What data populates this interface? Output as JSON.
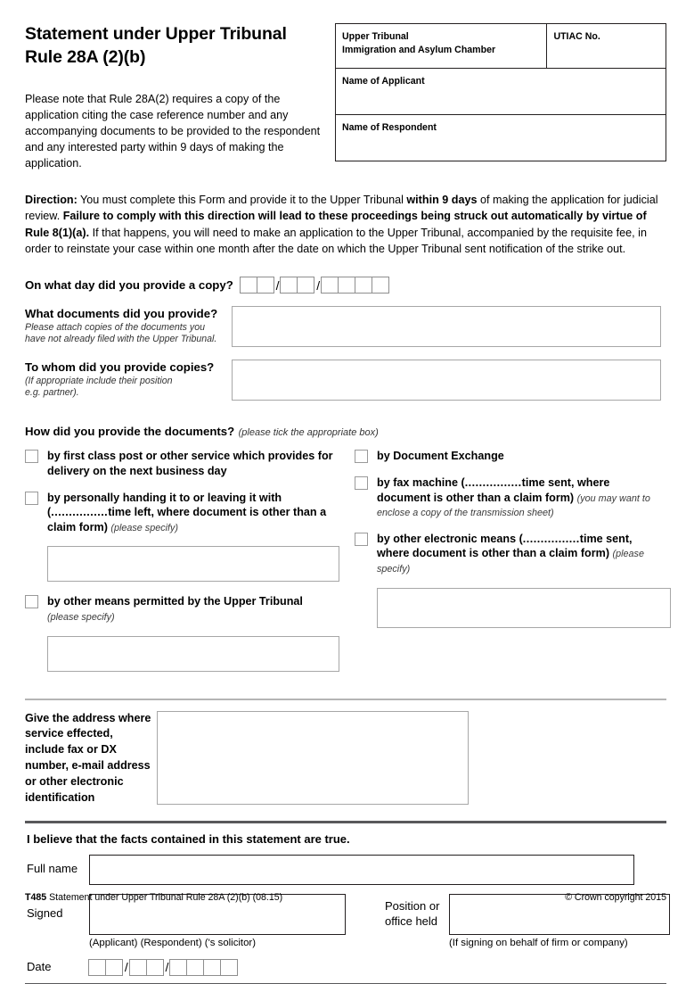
{
  "header": {
    "title": "Statement under Upper Tribunal Rule 28A (2)(b)",
    "intro": "Please note that Rule 28A(2) requires a copy of the application citing the case reference number and any accompanying documents to be provided to the respondent and any interested party within 9 days of making the application.",
    "box": {
      "chamber_line1": "Upper Tribunal",
      "chamber_line2": "Immigration and Asylum Chamber",
      "utiac_label": "UTIAC No.",
      "applicant_label": "Name of Applicant",
      "respondent_label": "Name of Respondent"
    }
  },
  "direction": {
    "lead": "Direction:",
    "part1": " You must complete this Form and provide it to the Upper Tribunal ",
    "bold1": "within 9 days",
    "part2": " of making the application for judicial review. ",
    "bold2": "Failure to comply with this direction will lead to these proceedings being struck out automatically by virtue of Rule 8(1)(a).",
    "part3": " If that happens, you will need to make an application to the Upper Tribunal, accompanied by the requisite fee, in order to reinstate your case within one month after the date on which the Upper Tribunal sent notification of the strike out."
  },
  "questions": {
    "day_provided": "On what day did you provide a copy?",
    "date_groups": [
      2,
      2,
      4
    ],
    "date_separator": "/",
    "what_documents": {
      "label": "What documents did you provide?",
      "sub_line1": "Please attach copies of the documents you",
      "sub_line2": "have not already filed with the Upper Tribunal."
    },
    "to_whom": {
      "label": "To whom did you provide copies?",
      "sub_line1": "(If appropriate include their position",
      "sub_line2": "e.g. partner)."
    }
  },
  "how_section": {
    "heading": "How did you provide the documents?",
    "heading_italic": "(please tick the appropriate box)",
    "left_options": [
      {
        "name": "first-class-post",
        "text": "by first class post or other service which provides for delivery on the next business day",
        "italic": "",
        "has_box": false
      },
      {
        "name": "personally-handing",
        "text_pre": "by personally handing it to or leaving it with (",
        "dots": "................",
        "text_post": "time left, where document is other than a claim form)",
        "italic": "(please specify)",
        "has_box": true
      },
      {
        "name": "other-means-permitted",
        "text": "by other means permitted by the Upper Tribunal",
        "italic": "(please specify)",
        "has_box": true
      }
    ],
    "right_options": [
      {
        "name": "document-exchange",
        "text": "by Document Exchange",
        "italic": "",
        "has_box": false
      },
      {
        "name": "fax-machine",
        "text_pre": "by fax machine (",
        "dots": "................",
        "text_post": "time sent, where document is other than a claim form)",
        "italic": "(you may want to enclose a copy of the transmission sheet)",
        "has_box": false
      },
      {
        "name": "other-electronic-means",
        "text_pre": "by other electronic means (",
        "dots": "................",
        "text_post": "time sent, where document is other than a claim form)",
        "italic": "(please specify)",
        "has_box": true
      }
    ]
  },
  "address_section": {
    "label": "Give the address where service effected, include fax or DX number, e-mail address or other electronic identification"
  },
  "statement": {
    "title": "I believe that the facts contained in this statement are true.",
    "full_name_label": "Full name",
    "signed_label": "Signed",
    "position_label_line1": "Position or",
    "position_label_line2": "office held",
    "signed_caption": "(Applicant) (Respondent) ('s solicitor)",
    "position_caption": "(If signing on behalf of firm or company)",
    "date_label": "Date",
    "date_groups": [
      2,
      2,
      4
    ]
  },
  "footer": {
    "code": "T485",
    "description": "Statement under Upper Tribunal Rule 28A (2)(b) (08.15)",
    "copyright": "© Crown copyright 2015"
  }
}
